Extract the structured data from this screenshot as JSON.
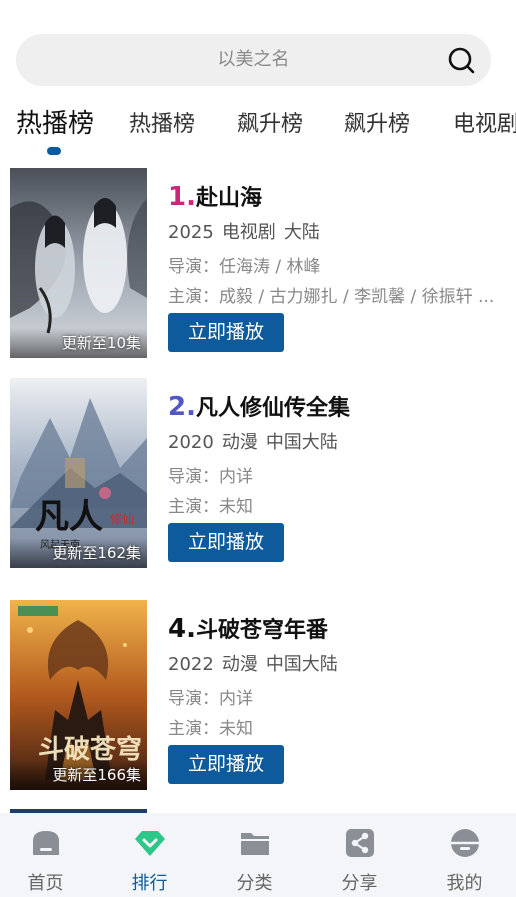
{
  "search": {
    "placeholder": "以美之名"
  },
  "tabs": [
    {
      "label": "热播榜",
      "active": true
    },
    {
      "label": "热播榜",
      "active": false
    },
    {
      "label": "飙升榜",
      "active": false
    },
    {
      "label": "飙升榜",
      "active": false
    },
    {
      "label": "电视剧",
      "active": false
    }
  ],
  "items": [
    {
      "rank": "1.",
      "rank_color": "#c8287a",
      "title": "赴山海",
      "year": "2025",
      "type": "电视剧",
      "region": "大陆",
      "director": "导演：任海涛 / 林峰",
      "actors": "主演：成毅 / 古力娜扎 / 李凯馨 / 徐振轩 ...",
      "badge": "更新至10集",
      "play_label": "立即播放"
    },
    {
      "rank": "2.",
      "rank_color": "#5157c9",
      "title": "凡人修仙传全集",
      "year": "2020",
      "type": "动漫",
      "region": "中国大陆",
      "director": "导演：内详",
      "actors": "主演：未知",
      "badge": "更新至162集",
      "play_label": "立即播放"
    },
    {
      "rank": "4.",
      "rank_color": "#111111",
      "title": "斗破苍穹年番",
      "year": "2022",
      "type": "动漫",
      "region": "中国大陆",
      "director": "导演：内详",
      "actors": "主演：未知",
      "badge": "更新至166集",
      "play_label": "立即播放"
    }
  ],
  "nav": [
    {
      "label": "首页",
      "icon": "home-icon",
      "active": false
    },
    {
      "label": "排行",
      "icon": "ranking-gem-icon",
      "active": true
    },
    {
      "label": "分类",
      "icon": "folder-icon",
      "active": false
    },
    {
      "label": "分享",
      "icon": "share-icon",
      "active": false
    },
    {
      "label": "我的",
      "icon": "profile-icon",
      "active": false
    }
  ],
  "colors": {
    "accent": "#0d5a9c",
    "active_icon": "#2ec78a",
    "inactive_icon": "#8a8f96"
  }
}
